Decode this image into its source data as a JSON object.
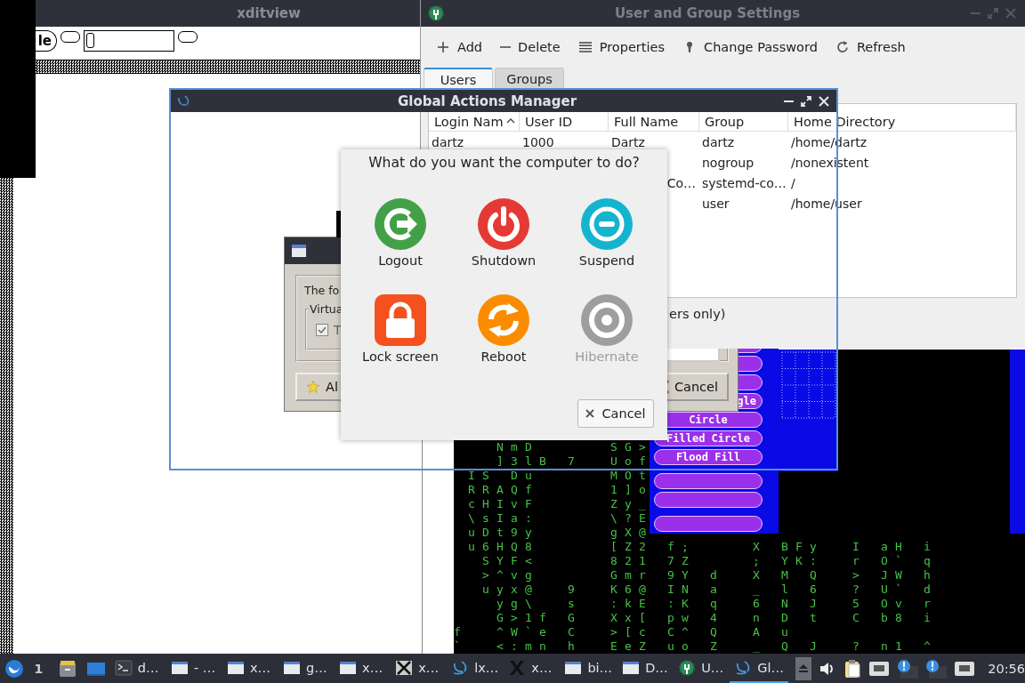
{
  "xditview": {
    "title": "xditview",
    "button_label": "le"
  },
  "user_settings": {
    "title": "User and Group Settings",
    "toolbar": [
      {
        "label": "Add",
        "kind": "plus"
      },
      {
        "label": "Delete",
        "kind": "minus"
      },
      {
        "label": "Properties",
        "kind": "list"
      },
      {
        "label": "Change Password",
        "kind": "key"
      },
      {
        "label": "Refresh",
        "kind": "refresh"
      }
    ],
    "tabs": [
      {
        "label": "Users",
        "selected": true
      },
      {
        "label": "Groups",
        "selected": false
      }
    ],
    "table": {
      "columns": [
        {
          "label": "Login Nam",
          "sorted": true
        },
        {
          "label": "User ID",
          "sorted": false
        },
        {
          "label": "Full Name",
          "sorted": false
        },
        {
          "label": "Group",
          "sorted": false
        },
        {
          "label": "Home Directory",
          "sorted": false
        }
      ],
      "rows": [
        {
          "cells": [
            "dartz",
            "1000",
            "Dartz",
            "dartz",
            "/home/dartz"
          ]
        },
        {
          "cells": [
            null,
            null,
            null,
            "nogroup",
            "/nonexistent"
          ]
        },
        {
          "cells": [
            null,
            null,
            {
              "text": "Co…",
              "clipped": true
            },
            "systemd-co…",
            "/"
          ]
        },
        {
          "cells": [
            null,
            null,
            null,
            "user",
            "/home/user"
          ]
        }
      ]
    },
    "option_label": "ers only)"
  },
  "old_dialog": {
    "message": "The fo",
    "group_label": "Virtua",
    "checkbox": {
      "label": "T",
      "checked": true
    },
    "buttons": [
      {
        "label": "Al",
        "kind": "star"
      },
      {
        "label": "Cancel",
        "kind": "cancel"
      }
    ]
  },
  "actions_manager": {
    "title": "Global Actions Manager"
  },
  "power_dialog": {
    "prompt": "What do you want the computer to do?",
    "actions": [
      {
        "label": "Logout",
        "kind": "logout",
        "disabled": false
      },
      {
        "label": "Shutdown",
        "kind": "shutdown",
        "disabled": false
      },
      {
        "label": "Suspend",
        "kind": "suspend",
        "disabled": false
      },
      {
        "label": "Lock screen",
        "kind": "lock",
        "disabled": false
      },
      {
        "label": "Reboot",
        "kind": "reboot",
        "disabled": false
      },
      {
        "label": "Hibernate",
        "kind": "hibernate",
        "disabled": true
      }
    ],
    "cancel": "Cancel"
  },
  "terminal": {
    "lines": [
      "   NmD     SG>",
      "   ]3lB 7  Uof",
      " IS Du     MOt",
      " RRAQf     1]o",
      " cHIvF     Zy_",
      " \\sIa:     \\?E",
      " uDt9y     gX@",
      " u6HQ8     [Z2 f;    X BFy  I aH i",
      "  SYF<     821 7Z    ; YK:  r O` q",
      "  >^vg     Gmr 9Y d  X M Q  > JW h",
      "  uyx@  9  K6@ IN a  _ l 6  ? U` d",
      "   yg\\  s  :kE :K q  6 N J  5 Ov r",
      "   G>1f G  Xx[ pw 4  n D t  C b8 i",
      "f  ^W`e C  >[c C^ Q  A u",
      "`  <:mn h  EeZ uo Z  _ Q J  ? n1 ^"
    ]
  },
  "paint_tools": {
    "buttons": [
      {
        "kind": "blank"
      },
      {
        "kind": "blank"
      },
      {
        "kind": "blank"
      },
      {
        "kind": "text",
        "label": "gle",
        "clipped": true
      },
      {
        "kind": "text",
        "label": "Circle",
        "clipped": false
      },
      {
        "kind": "text",
        "label": "Filled Circle",
        "clipped": false
      },
      {
        "kind": "text",
        "label": "Flood Fill",
        "clipped": false
      },
      {
        "kind": "blank"
      },
      {
        "kind": "blank"
      },
      {
        "kind": "blank"
      }
    ]
  },
  "taskbar": {
    "workspace": "1",
    "tasks": [
      {
        "label": "d…",
        "kind": "terminal",
        "active": false
      },
      {
        "label": "- …",
        "kind": "window",
        "active": false
      },
      {
        "label": "x…",
        "kind": "window",
        "active": false
      },
      {
        "label": "g…",
        "kind": "window",
        "active": false
      },
      {
        "label": "x…",
        "kind": "window",
        "active": false
      },
      {
        "label": "x…",
        "kind": "xbitmap",
        "active": false
      },
      {
        "label": "lx…",
        "kind": "swirl",
        "active": false
      },
      {
        "label": "x…",
        "kind": "xlogo",
        "active": false
      },
      {
        "label": "bi…",
        "kind": "window",
        "active": false
      },
      {
        "label": "D…",
        "kind": "window",
        "active": false
      },
      {
        "label": "U…",
        "kind": "gear",
        "active": false
      },
      {
        "label": "Gl…",
        "kind": "swirl",
        "active": true
      }
    ],
    "clock": "20:56"
  }
}
